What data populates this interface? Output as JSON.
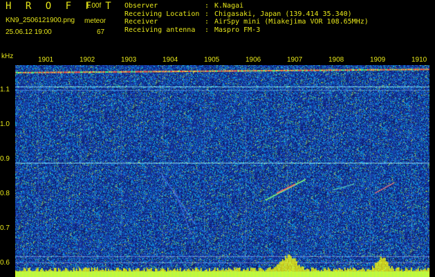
{
  "header": {
    "app_title": "H R O F F T",
    "version": "1.00f",
    "filename": "KN9_2506121900.png",
    "meteor_label": "meteor",
    "datetime": "25.06.12 19:00",
    "meteor_count": "67",
    "info": [
      {
        "key": "Observer",
        "value": "K.Nagai"
      },
      {
        "key": "Receiving Location",
        "value": "Chigasaki, Japan (139.414 35.340)"
      },
      {
        "key": "Receiver",
        "value": "AirSpy mini (Miakejima VOR 108.65MHz)"
      },
      {
        "key": "Receiving antenna",
        "value": "Maspro FM-3"
      }
    ]
  },
  "spectrogram": {
    "y_unit": "kHz",
    "x_ticks": [
      "1901",
      "1902",
      "1903",
      "1904",
      "1905",
      "1906",
      "1907",
      "1908",
      "1909",
      "1910"
    ],
    "y_ticks": [
      "1.1",
      "1.0",
      "0.9",
      "0.8",
      "0.7",
      "0.6"
    ],
    "colors": {
      "background": "#1a3a9e",
      "text": "#e6e61a",
      "activity_bars": "#ffff00",
      "baseline": "#00e5ff"
    }
  }
}
